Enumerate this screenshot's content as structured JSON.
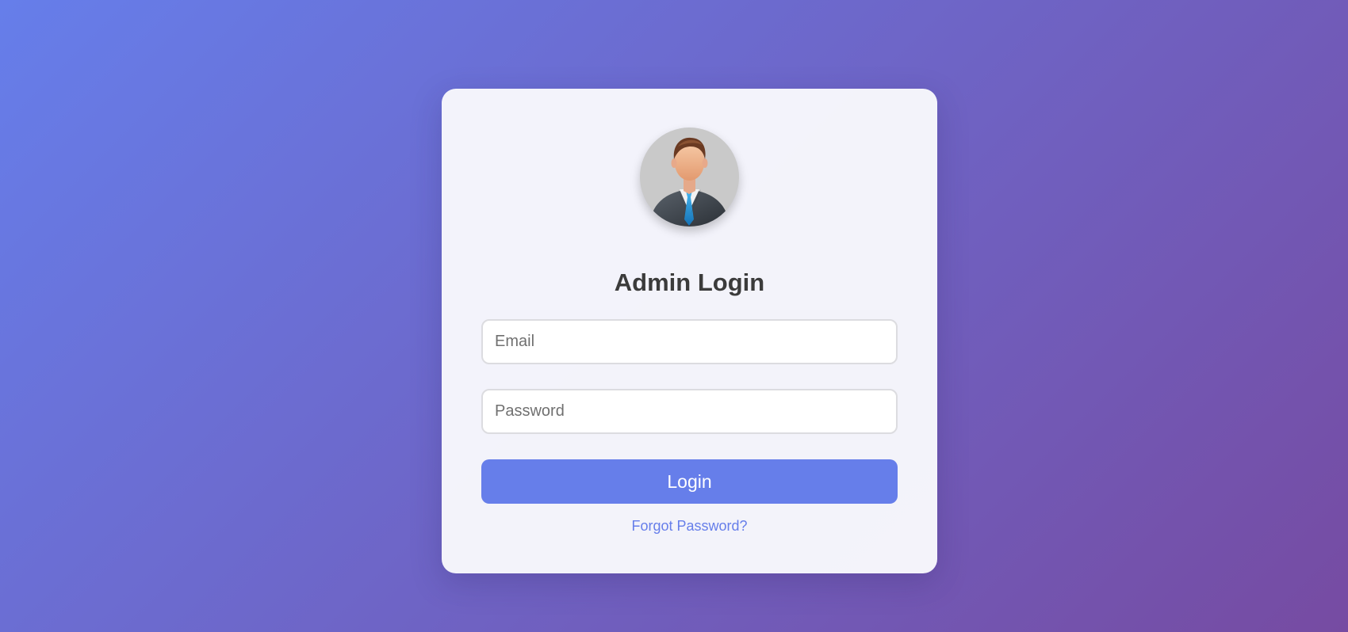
{
  "login": {
    "title": "Admin Login",
    "email_placeholder": "Email",
    "password_placeholder": "Password",
    "submit_label": "Login",
    "forgot_label": "Forgot Password?"
  },
  "colors": {
    "gradient_start": "#667eea",
    "gradient_end": "#764ba2",
    "accent": "#667eea",
    "card_background": "#f8f8fc"
  },
  "icons": {
    "avatar": "admin-avatar-icon"
  }
}
